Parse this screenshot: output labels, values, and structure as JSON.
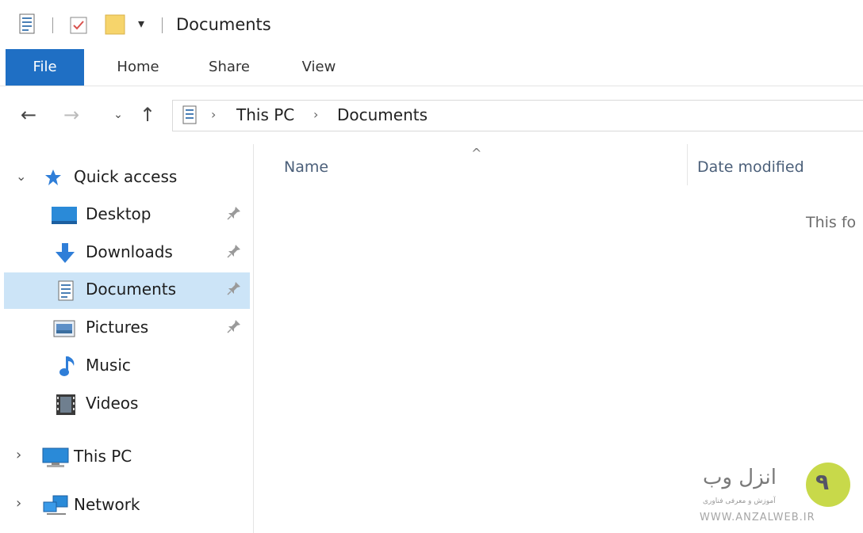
{
  "window": {
    "title": "Documents"
  },
  "ribbon": {
    "tabs": [
      {
        "label": "File",
        "active": true
      },
      {
        "label": "Home"
      },
      {
        "label": "Share"
      },
      {
        "label": "View"
      }
    ]
  },
  "address": {
    "crumbs": [
      "This PC",
      "Documents"
    ]
  },
  "sidebar": {
    "quick_access": "Quick access",
    "items": [
      {
        "label": "Desktop",
        "icon": "desktop-icon",
        "pinned": true
      },
      {
        "label": "Downloads",
        "icon": "downloads-icon",
        "pinned": true
      },
      {
        "label": "Documents",
        "icon": "documents-icon",
        "pinned": true,
        "selected": true
      },
      {
        "label": "Pictures",
        "icon": "pictures-icon",
        "pinned": true
      },
      {
        "label": "Music",
        "icon": "music-icon"
      },
      {
        "label": "Videos",
        "icon": "videos-icon"
      }
    ],
    "this_pc": "This PC",
    "network": "Network"
  },
  "content": {
    "columns": [
      "Name",
      "Date modified"
    ],
    "empty_message": "This fo"
  },
  "watermark": {
    "brand": "انزل وب",
    "tagline": "آموزش و معرفی فناوری",
    "url": "WWW.ANZALWEB.IR"
  },
  "colors": {
    "accent": "#1f6fc4",
    "selection": "#cce4f7"
  }
}
